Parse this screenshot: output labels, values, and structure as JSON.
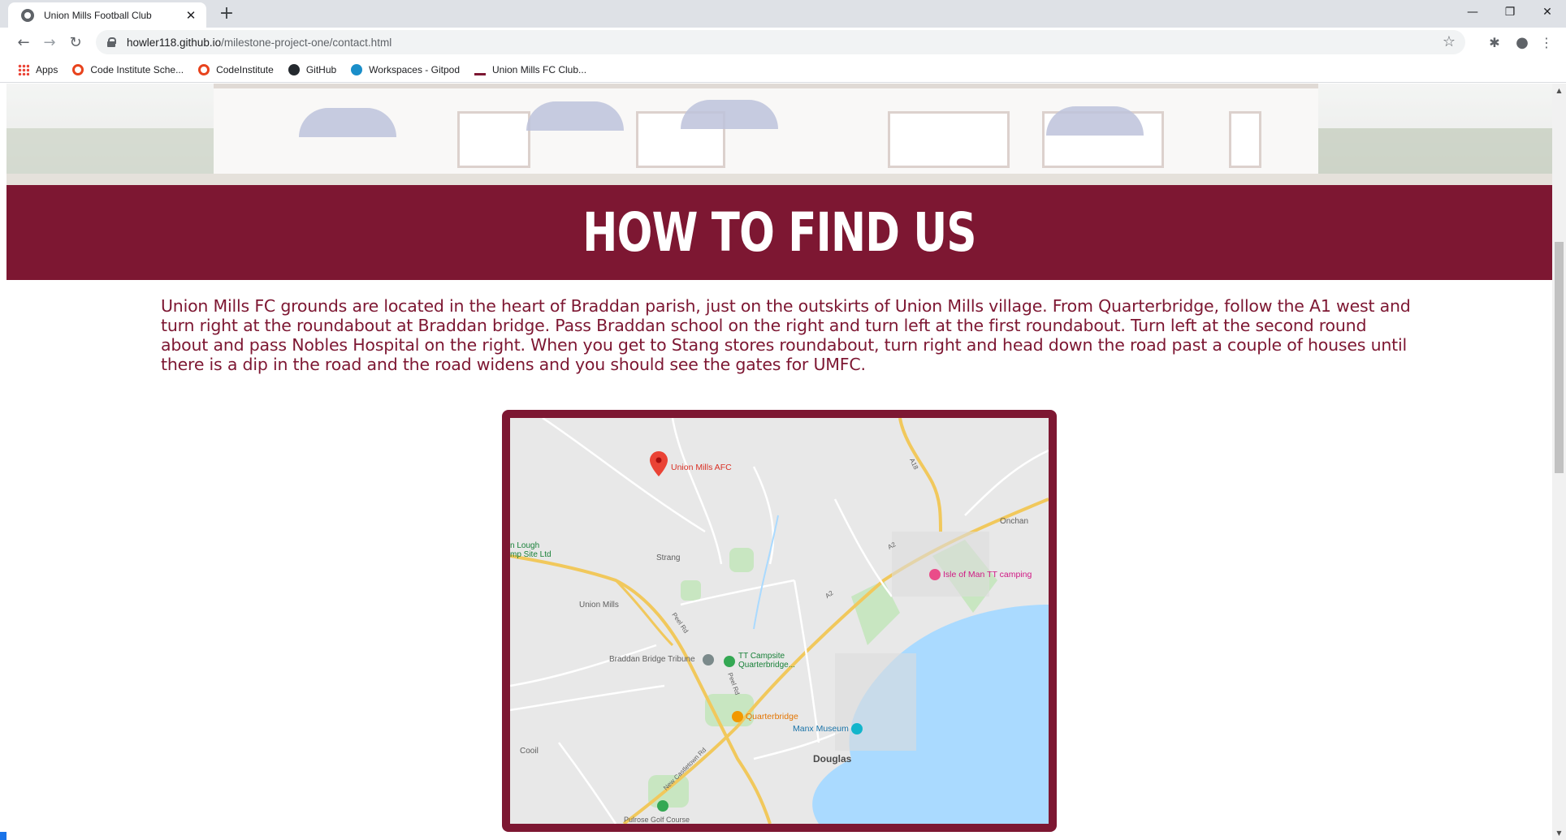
{
  "browser": {
    "tab_title": "Union Mills Football Club",
    "url_host": "howler118.github.io",
    "url_path": "/milestone-project-one/contact.html",
    "bookmarks": [
      {
        "label": "Apps",
        "icon": "apps-icon"
      },
      {
        "label": "Code Institute Sche...",
        "icon": "code-institute-icon"
      },
      {
        "label": "CodeInstitute",
        "icon": "code-institute-icon"
      },
      {
        "label": "GitHub",
        "icon": "github-icon"
      },
      {
        "label": "Workspaces - Gitpod",
        "icon": "gitpod-icon"
      },
      {
        "label": "Union Mills FC Club...",
        "icon": "union-mills-icon"
      }
    ]
  },
  "page": {
    "heading": "HOW TO FIND US",
    "directions": "Union Mills FC grounds are located in the heart of Braddan parish, just on the outskirts of Union Mills village. From Quarterbridge, follow the A1 west and turn right at the roundabout at Braddan bridge. Pass Braddan school on the right and turn left at the first roundabout. Turn left at the second round about and pass Nobles Hospital on the right. When you get to Stang stores roundabout, turn right and head down the road past a couple of houses until there is a dip in the road and the road widens and you should see the gates for UMFC.",
    "accent_color": "#7d1732"
  },
  "map": {
    "labels": {
      "union_mills_afc": "Union Mills AFC",
      "lough": "n Lough",
      "camp_site": "mp Site Ltd",
      "strang": "Strang",
      "union_mills": "Union Mills",
      "braddan_bridge": "Braddan Bridge Tribune",
      "tt_campsite_1": "TT Campsite",
      "tt_campsite_2": "Quarterbridge...",
      "quarterbridge": "Quarterbridge",
      "manx_museum": "Manx Museum",
      "douglas": "Douglas",
      "onchan": "Onchan",
      "iom_tt_camping": "Isle of Man TT camping",
      "cooil": "Cooil",
      "peel_rd": "Peel Rd",
      "peel_rd_2": "Peel Rd",
      "a2": "A2",
      "a2_b": "A2",
      "a18": "A18",
      "new_castletown_rd": "New Castletown Rd",
      "pulrose": "Pulrose Golf Course"
    }
  }
}
